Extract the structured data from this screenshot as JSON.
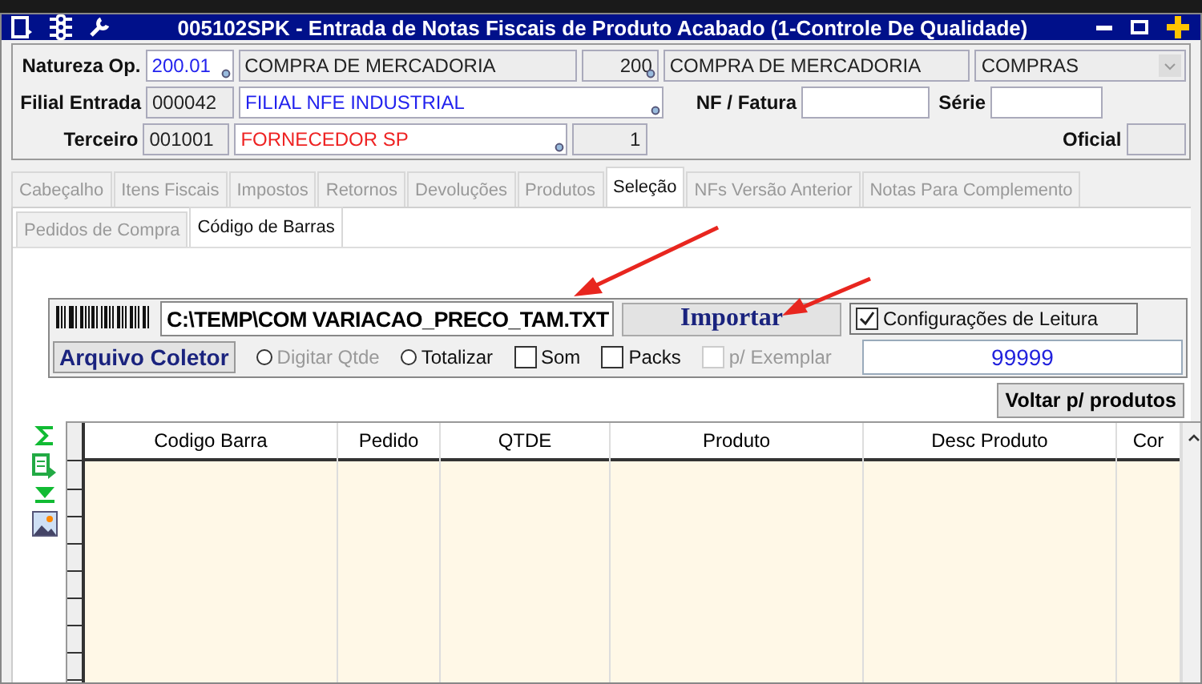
{
  "window": {
    "title": "005102SPK - Entrada de Notas Fiscais de Produto Acabado (1-Controle De Qualidade)"
  },
  "header": {
    "natureza": {
      "label": "Natureza Op.",
      "code": "200.01",
      "description": "COMPRA DE MERCADORIA",
      "number": "200",
      "description_2": "COMPRA DE MERCADORIA",
      "select": "COMPRAS"
    },
    "filial": {
      "label": "Filial Entrada",
      "code": "000042",
      "description": "FILIAL NFE INDUSTRIAL",
      "nf_label": "NF / Fatura",
      "serie_label": "Série"
    },
    "terceiro": {
      "label": "Terceiro",
      "code": "001001",
      "description": "FORNECEDOR SP",
      "number": "1",
      "oficial_label": "Oficial"
    }
  },
  "tabs": [
    {
      "label": "Cabeçalho",
      "selected": false
    },
    {
      "label": "Itens Fiscais",
      "selected": false
    },
    {
      "label": "Impostos",
      "selected": false
    },
    {
      "label": "Retornos",
      "selected": false
    },
    {
      "label": "Devoluções",
      "selected": false
    },
    {
      "label": "Produtos",
      "selected": false
    },
    {
      "label": "Seleção",
      "selected": true
    },
    {
      "label": "NFs Versão Anterior",
      "selected": false
    },
    {
      "label": "Notas Para Complemento",
      "selected": false
    }
  ],
  "subtabs": [
    {
      "label": "Pedidos de Compra",
      "selected": false
    },
    {
      "label": "Código de Barras",
      "selected": true
    }
  ],
  "barcode": {
    "path": "C:\\TEMP\\COM VARIACAO_PRECO_TAM.TXT",
    "import_button": "Importar",
    "config": {
      "label": "Configurações de Leitura",
      "checked": true
    },
    "collector_button": "Arquivo Coletor",
    "options": [
      {
        "kind": "radio",
        "label": "Digitar Qtde",
        "selected": false,
        "disabled": true
      },
      {
        "kind": "radio",
        "label": "Totalizar",
        "selected": false,
        "disabled": false
      },
      {
        "kind": "checkbox",
        "label": "Som",
        "checked": false,
        "disabled": false
      },
      {
        "kind": "checkbox",
        "label": "Packs",
        "checked": false,
        "disabled": false
      },
      {
        "kind": "checkbox",
        "label": "p/ Exemplar",
        "checked": false,
        "disabled": true
      }
    ],
    "value": "99999"
  },
  "back_button": "Voltar p/ produtos",
  "grid": {
    "columns": [
      "Codigo Barra",
      "Pedido",
      "QTDE",
      "Produto",
      "Desc Produto",
      "Cor"
    ]
  }
}
